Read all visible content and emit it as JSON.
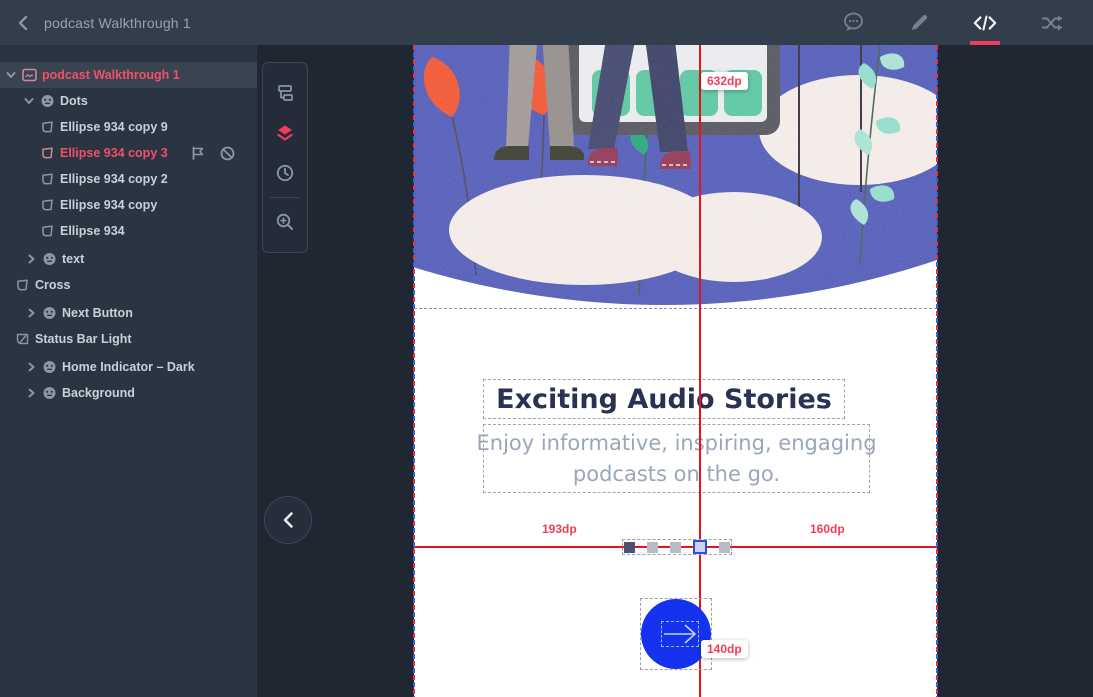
{
  "topbar": {
    "title": "podcast Walkthrough 1",
    "back_icon": "chevron-left",
    "icons": [
      "comment-bubble",
      "pencil",
      "code",
      "shuffle"
    ],
    "active_icon": "code",
    "accent_underline_color": "#f13c5e"
  },
  "sidebar": {
    "rows": [
      {
        "label": "podcast Walkthrough 1",
        "type": "artboard",
        "caret": "expanded",
        "state": "selected"
      },
      {
        "label": "Dots",
        "type": "group",
        "caret": "expanded"
      },
      {
        "label": "Ellipse 934 copy 9",
        "type": "shape"
      },
      {
        "label": "Ellipse 934 copy 3",
        "type": "shape",
        "state": "selected",
        "trailing_icons": [
          "flag",
          "disabled"
        ]
      },
      {
        "label": "Ellipse 934 copy 2",
        "type": "shape"
      },
      {
        "label": "Ellipse 934 copy",
        "type": "shape"
      },
      {
        "label": "Ellipse 934",
        "type": "shape"
      },
      {
        "label": "text",
        "type": "group",
        "caret": "collapsed"
      },
      {
        "label": "Cross",
        "type": "shape"
      },
      {
        "label": "Next Button",
        "type": "group",
        "caret": "collapsed"
      },
      {
        "label": "Status Bar Light",
        "type": "component"
      },
      {
        "label": "Home Indicator – Dark",
        "type": "group",
        "caret": "collapsed"
      },
      {
        "label": "Background",
        "type": "group",
        "caret": "collapsed"
      }
    ]
  },
  "toolbar": {
    "icons": [
      "layer-tree",
      "layers-stack",
      "history",
      "zoom-in"
    ],
    "active_icon": "layers-stack"
  },
  "canvas": {
    "heading": "Exciting Audio Stories",
    "subtitle_line1": "Enjoy informative, inspiring, engaging",
    "subtitle_line2": "podcasts on the go.",
    "dots_total": 5,
    "selected_dot": 4,
    "measurements": {
      "vertical": "632dp",
      "left": "193dp",
      "right": "160dp",
      "button": "140dp"
    }
  },
  "colors": {
    "accent_pink": "#f05069",
    "red_guide": "#e3131f",
    "button_blue": "#1533ee",
    "illustration_blue": "#4c56b5",
    "title_text": "#2b3152",
    "subtitle_text": "#9aa6bc"
  }
}
